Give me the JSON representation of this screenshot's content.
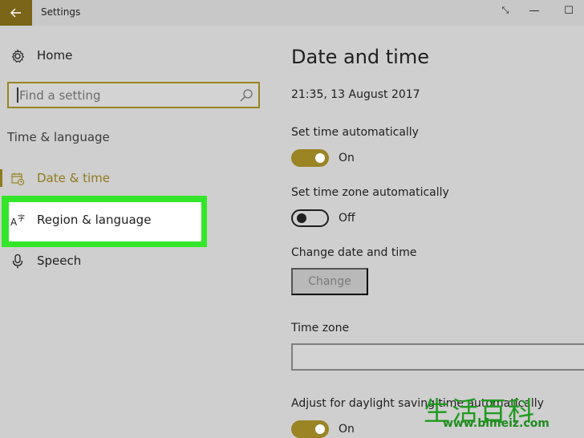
{
  "window": {
    "title": "Settings",
    "controls": {
      "restore_glyph": "⤡",
      "minimize_glyph": "—",
      "maximize_glyph": "☐"
    }
  },
  "sidebar": {
    "home_label": "Home",
    "search_placeholder": "Find a setting",
    "section_heading": "Time & language",
    "items": [
      {
        "label": "Date & time",
        "icon": "calendar-clock-icon",
        "selected": true
      },
      {
        "label": "Region & language",
        "icon": "language-icon",
        "selected": false,
        "highlighted": true
      },
      {
        "label": "Speech",
        "icon": "microphone-icon",
        "selected": false
      }
    ]
  },
  "main": {
    "title": "Date and time",
    "current_datetime": "21:35, 13 August 2017",
    "set_time_auto": {
      "label": "Set time automatically",
      "state": "On"
    },
    "set_timezone_auto": {
      "label": "Set time zone automatically",
      "state": "Off"
    },
    "change_date_time": {
      "label": "Change date and time",
      "button": "Change"
    },
    "time_zone": {
      "label": "Time zone",
      "value": ""
    },
    "daylight": {
      "label": "Adjust for daylight saving time automatically",
      "state": "On"
    }
  },
  "watermark": {
    "chars": "生活百科",
    "url": "www.bimeiz.com"
  },
  "colors": {
    "accent": "#9a8424",
    "back_button": "#7a6518",
    "highlight": "#33e62a",
    "background": "#cfcfcf"
  }
}
